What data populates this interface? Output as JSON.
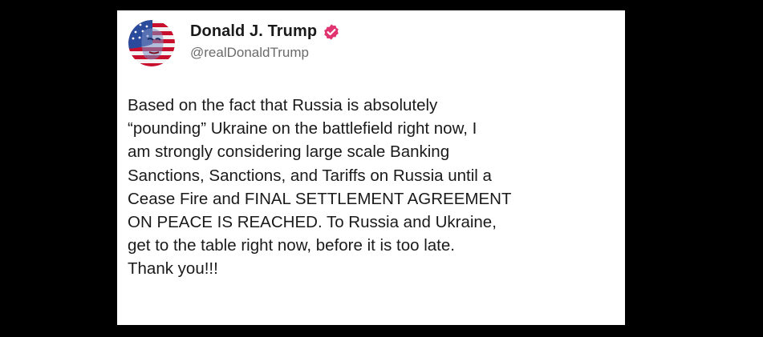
{
  "post": {
    "author": {
      "display_name": "Donald J. Trump",
      "handle": "@realDonaldTrump",
      "avatar_icon": "american-flag-face-avatar",
      "verified_icon": "verified-badge-icon",
      "verified_color": "#e0336f"
    },
    "text": "Based on the fact that Russia is absolutely\n“pounding” Ukraine on the battlefield right now, I\nam strongly considering large scale Banking\nSanctions, Sanctions, and Tariffs on Russia until a\nCease Fire and FINAL SETTLEMENT AGREEMENT\nON PEACE IS REACHED. To Russia and Ukraine,\nget to the table right now, before it is too late.\nThank you!!!"
  },
  "colors": {
    "background": "#000000",
    "card": "#ffffff",
    "text": "#1a1a1a",
    "handle": "#6b6b6b"
  }
}
